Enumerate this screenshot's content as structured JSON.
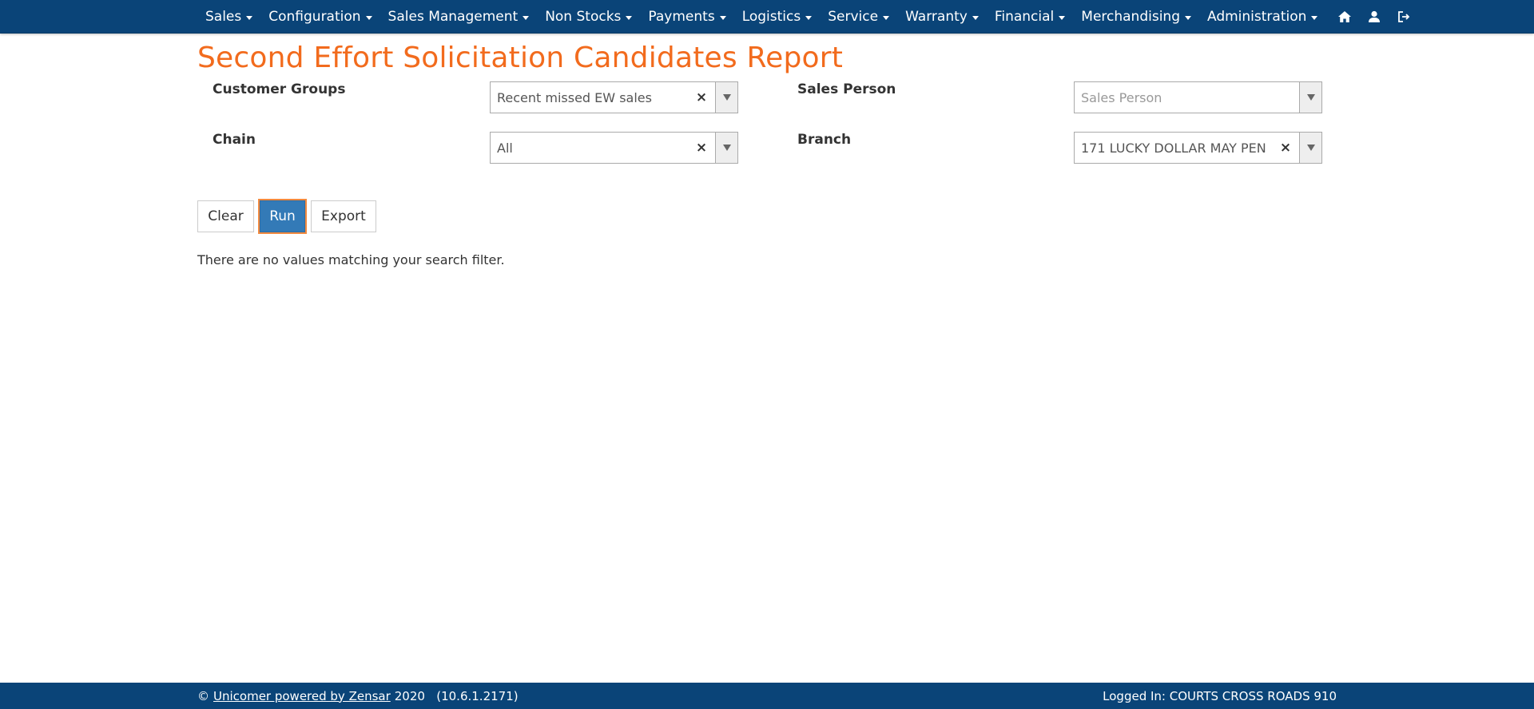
{
  "nav": {
    "menus": [
      {
        "label": "Sales"
      },
      {
        "label": "Configuration"
      },
      {
        "label": "Sales Management"
      },
      {
        "label": "Non Stocks"
      },
      {
        "label": "Payments"
      },
      {
        "label": "Logistics"
      },
      {
        "label": "Service"
      },
      {
        "label": "Warranty"
      },
      {
        "label": "Financial"
      },
      {
        "label": "Merchandising"
      },
      {
        "label": "Administration"
      }
    ],
    "icons": [
      "home-icon",
      "user-icon",
      "logout-icon"
    ]
  },
  "page": {
    "title": "Second Effort Solicitation Candidates Report"
  },
  "filters": {
    "customer_groups": {
      "label": "Customer Groups",
      "value": "Recent missed EW sales",
      "clear": "×"
    },
    "sales_person": {
      "label": "Sales Person",
      "placeholder": "Sales Person"
    },
    "chain": {
      "label": "Chain",
      "value": "All",
      "clear": "×"
    },
    "branch": {
      "label": "Branch",
      "value": "171 LUCKY DOLLAR MAY PEN",
      "clear": "×"
    }
  },
  "actions": {
    "clear_label": "Clear",
    "run_label": "Run",
    "export_label": "Export"
  },
  "results": {
    "empty_message": "There are no values matching your search filter."
  },
  "footer": {
    "copyright": "©",
    "link_text": "Unicomer powered by Zensar",
    "year_version": "2020   (10.6.1.2171)",
    "logged_in": "Logged In: COURTS CROSS ROADS 910"
  },
  "colors": {
    "navbar_bg": "#0a4478",
    "title_orange": "#f26b1d",
    "primary_button": "#337ab7",
    "focus_ring": "#f28a3f"
  }
}
